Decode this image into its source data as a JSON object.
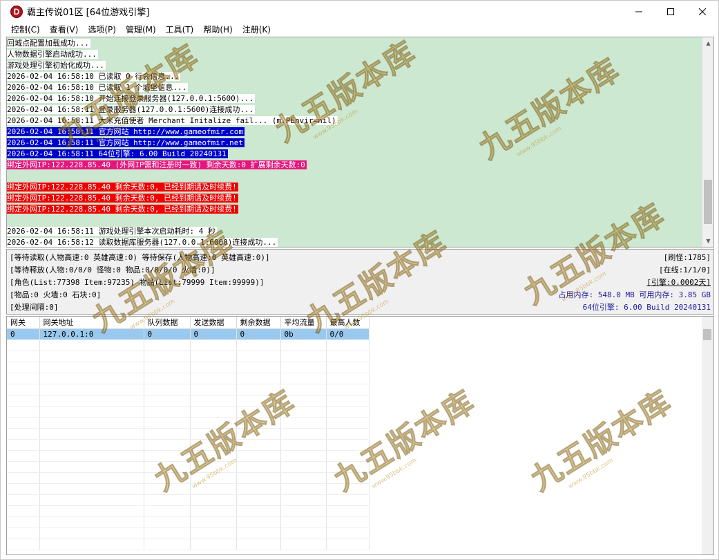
{
  "window": {
    "title": "霸主传说01区 [64位游戏引擎]",
    "app_icon_letter": "D"
  },
  "menu": [
    "控制(C)",
    "查看(V)",
    "选项(P)",
    "管理(M)",
    "工具(T)",
    "帮助(H)",
    "注册(K)"
  ],
  "log_lines": [
    {
      "text": "回城点配置加载成功...",
      "style": "white"
    },
    {
      "text": "人物数据引擎启动成功...",
      "style": "white"
    },
    {
      "text": "游戏处理引擎初始化成功...",
      "style": "white"
    },
    {
      "text": "2026-02-04 16:58:10 已读取 0 行会信息...",
      "style": "white"
    },
    {
      "text": "2026-02-04 16:58:10 已读取 1 个城堡信息...",
      "style": "white"
    },
    {
      "text": "2026-02-04 16:58:10 开始连接登录服务器(127.0.0.1:5600)...",
      "style": "white"
    },
    {
      "text": "2026-02-04 16:58:11 登录服务器(127.0.0.1:5600)连接成功...",
      "style": "white"
    },
    {
      "text": "2026-02-04 16:58:11 大米充值使者 Merchant Initalize fail... (m.PEnvir=nil)",
      "style": "white"
    },
    {
      "text": "2026-02-04 16:58:11 官方网站 http://www.gameofmir.com",
      "style": "blue"
    },
    {
      "text": "2026-02-04 16:58:11 官方网站 http://www.gameofmir.net",
      "style": "blue"
    },
    {
      "text": "2026-02-04 16:58:11 64位引擎: 6.00 Build 20240131",
      "style": "blue"
    },
    {
      "text": "绑定外网IP:122.228.85.40 (外网IP需和注册时一致) 剩余天数:0 扩展剩余天数:0",
      "style": "pink"
    },
    {
      "text": "",
      "style": "none"
    },
    {
      "text": "绑定外网IP:122.228.85.40 剩余天数:0, 已经到期请及时续费!",
      "style": "red"
    },
    {
      "text": "绑定外网IP:122.228.85.40 剩余天数:0, 已经到期请及时续费!",
      "style": "red"
    },
    {
      "text": "绑定外网IP:122.228.85.40 剩余天数:0, 已经到期请及时续费!",
      "style": "red"
    },
    {
      "text": "",
      "style": "none"
    },
    {
      "text": "2026-02-04 16:58:11 游戏处理引擎本次启动耗时: 4 秒",
      "style": "white"
    },
    {
      "text": "2026-02-04 16:58:12 读取数据库服务器(127.0.0.1:6000)连接成功...",
      "style": "white"
    }
  ],
  "status": {
    "left": [
      "[等待读取(人物高速:0 英雄高速:0) 等待保存(人物高速:0 英雄高速:0)]",
      "[等待释放(人物:0/0/0 怪物:0 物品:0/0/0/0 火墙:0)]",
      "[角色(List:77398 Item:97235) 物品(List:79999 Item:99999)]",
      "[物品:0 火墙:0 石块:0]",
      "[处理间隔:0]"
    ],
    "refresh_monsters": "[刷怪:1785]",
    "online": "[在线:1/1/0]",
    "engine": "[引擎:0.0002天]",
    "memory": "占用内存: 548.0 MB 可用内存: 3.85 GB",
    "version": "64位引擎: 6.00 Build 20240131"
  },
  "gateway_table": {
    "headers": [
      "网关",
      "网关地址",
      "队列数据",
      "发送数据",
      "剩余数据",
      "平均流量",
      "最高人数"
    ],
    "rows": [
      [
        "0",
        "127.0.0.1:0",
        "0",
        "0",
        "0",
        "0b",
        "0/0"
      ]
    ]
  },
  "watermark": {
    "main": "九五版本库",
    "url": "www.95bbk.com"
  }
}
